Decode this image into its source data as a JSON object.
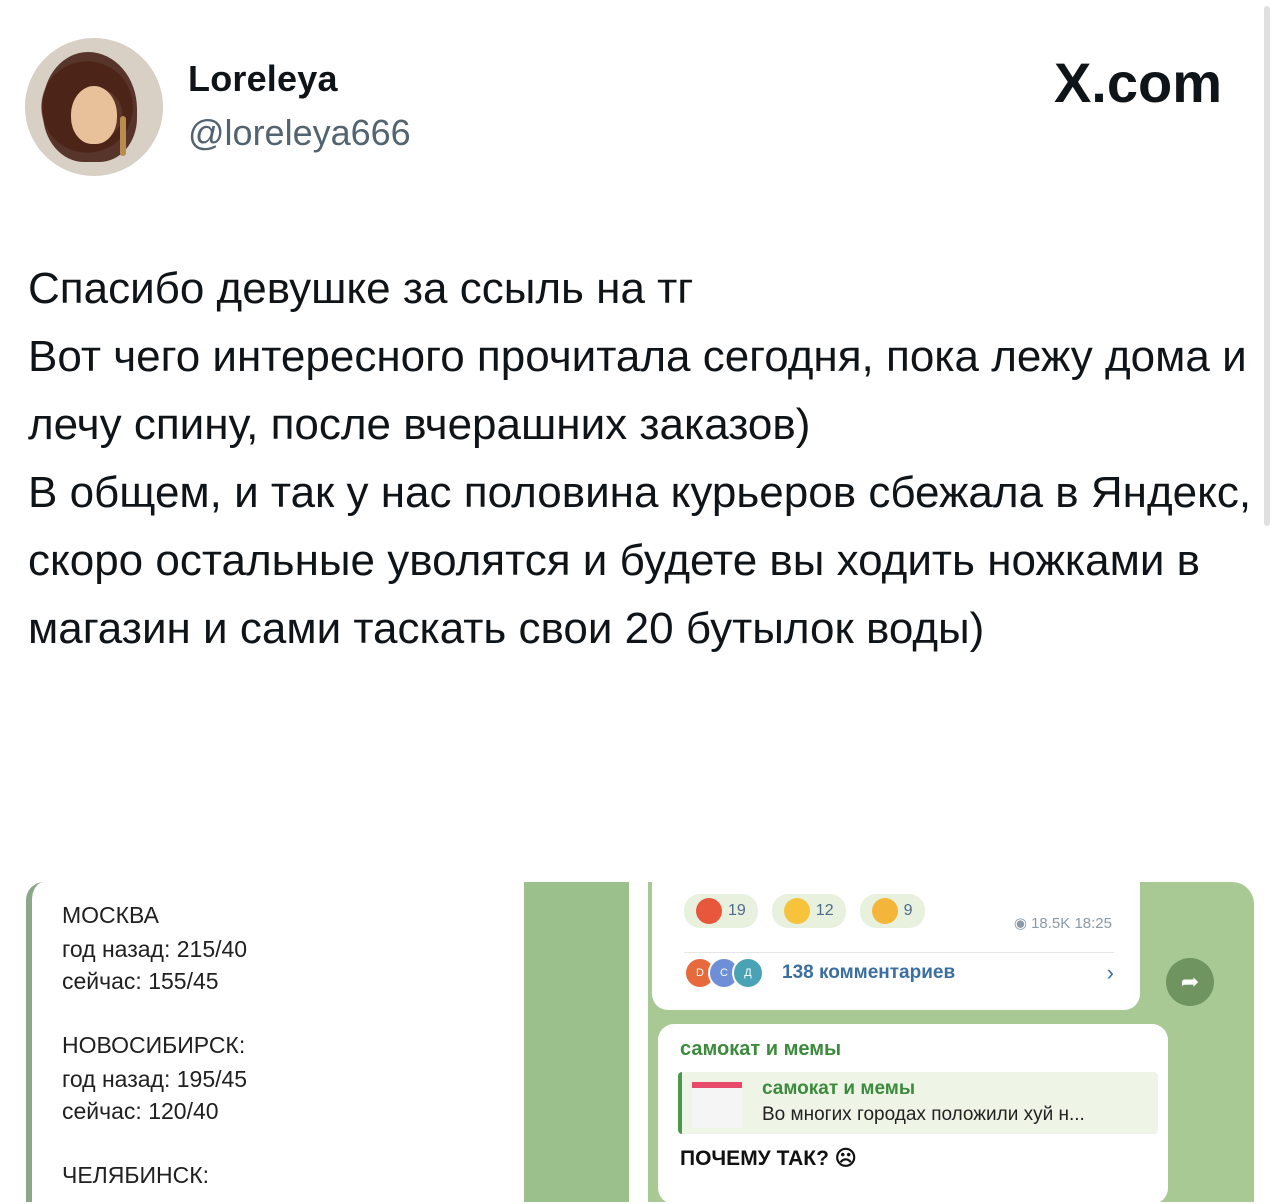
{
  "author": {
    "name": "Loreleya",
    "handle": "@loreleya666"
  },
  "brand": "X.com",
  "tweet": {
    "text": "Спасибо девушке за ссыль на тг\nВот чего интересного прочитала сегодня, пока лежу дома и лечу спину, после вчерашних заказов)\nВ общем, и так у нас половина курьеров сбежала в Яндекс, скоро остальные уволятся и будете вы ходить ножками в магазин и сами таскать свои 20 бутылок воды)"
  },
  "image_left": {
    "cities": [
      {
        "name": "МОСКВА",
        "year_ago": "год назад: 215/40",
        "now": "сейчас: 155/45"
      },
      {
        "name": "НОВОСИБИРСК:",
        "year_ago": "год назад: 195/45",
        "now": "сейчас: 120/40"
      },
      {
        "name": "ЧЕЛЯБИНСК:"
      }
    ]
  },
  "image_right": {
    "reactions": [
      {
        "icon": "angry-face-emoji",
        "count": "19"
      },
      {
        "icon": "starstruck-face-emoji",
        "count": "12"
      },
      {
        "icon": "rofl-face-emoji",
        "count": "9"
      }
    ],
    "views": "18.5K",
    "time": "18:25",
    "comment_avatars": [
      "D",
      "С",
      "Д"
    ],
    "comments_label": "138 комментариев",
    "chat_name": "самокат и мемы",
    "quote_title": "самокат и мемы",
    "quote_text": "Во многих городах положили хуй н...",
    "message": "ПОЧЕМУ ТАК?",
    "colors": {
      "header_green": "#3c8b3c",
      "link_blue": "#3b6fa1"
    }
  }
}
